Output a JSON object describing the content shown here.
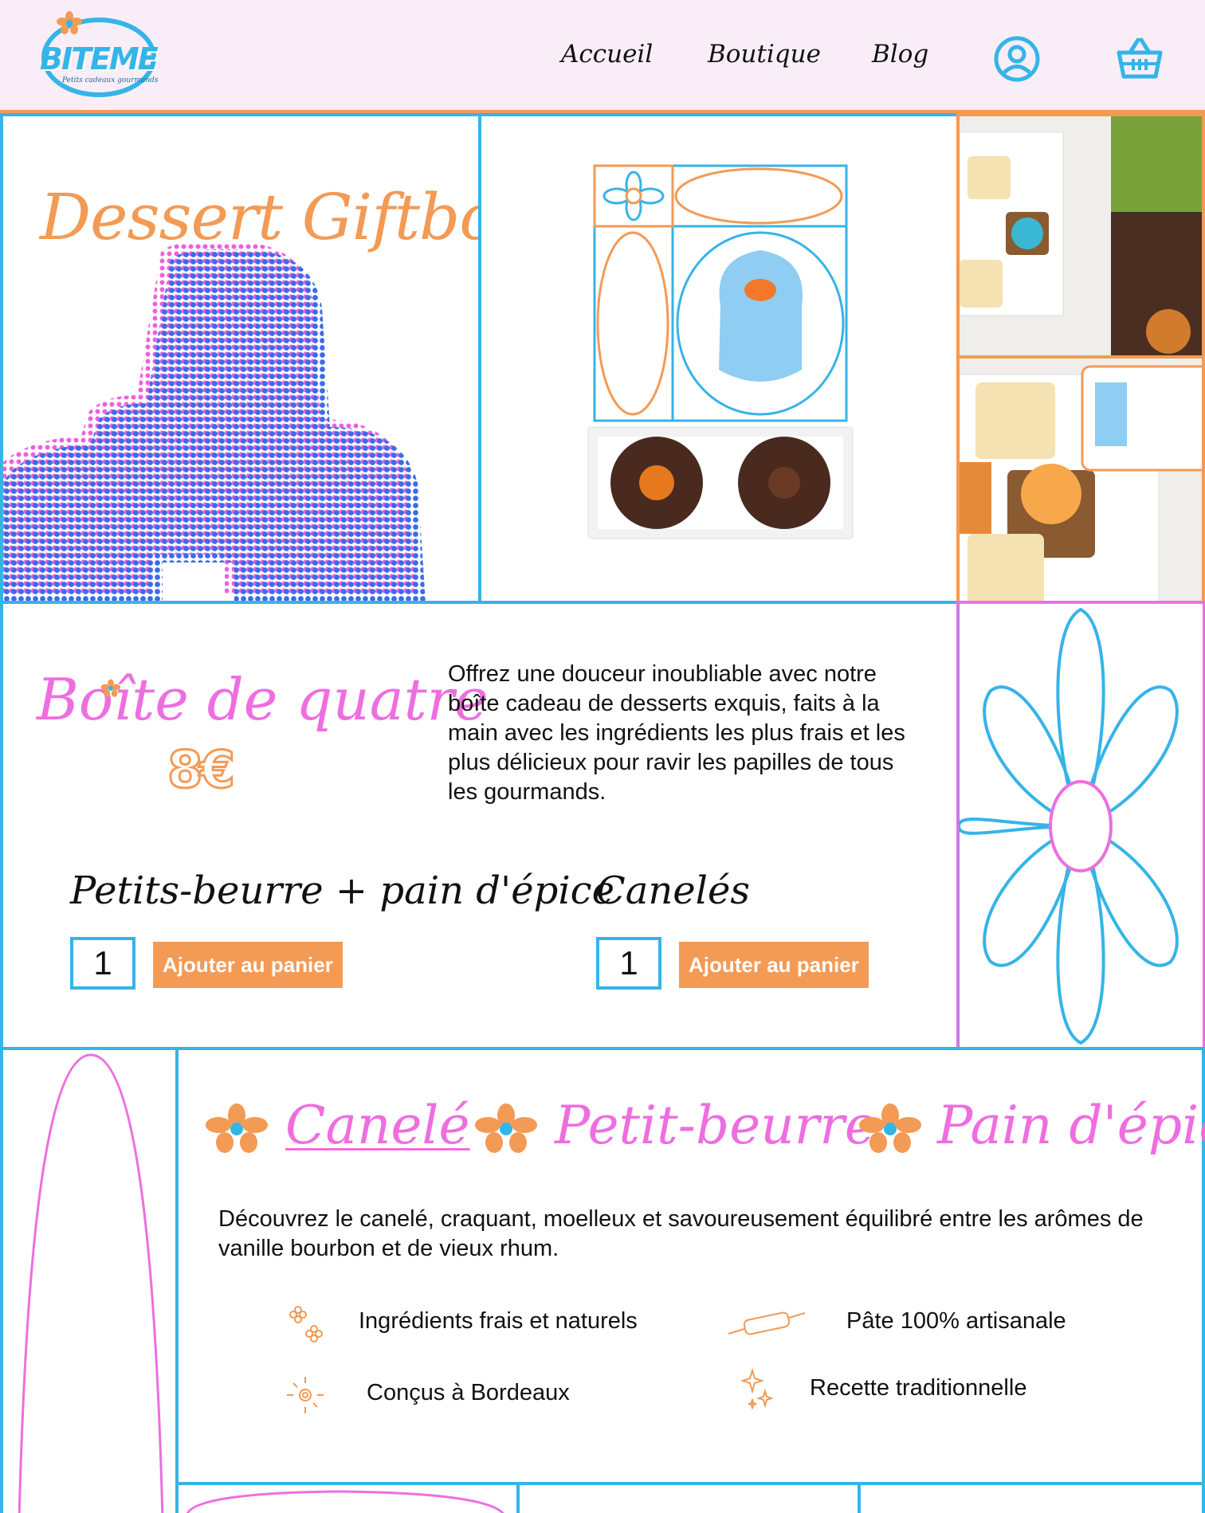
{
  "brand": {
    "name": "BITEME",
    "tagline": "Petits cadeaux gourmands"
  },
  "nav": {
    "items": [
      "Accueil",
      "Boutique",
      "Blog"
    ]
  },
  "hero": {
    "title": "Dessert Giftbox"
  },
  "product": {
    "title": "Boîte de quatre",
    "price": "8€",
    "description": "Offrez une douceur inoubliable avec notre boîte cadeau de desserts exquis, faits à la main avec les ingrédients les plus frais et les plus délicieux pour ravir les papilles de tous les gourmands.",
    "options": [
      {
        "name": "Petits-beurre + pain d'épice",
        "qty": "1",
        "button": "Ajouter au panier"
      },
      {
        "name": "Canelés",
        "qty": "1",
        "button": "Ajouter au panier"
      }
    ]
  },
  "tabs": {
    "items": [
      "Canelé",
      "Petit-beurre",
      "Pain d'épice"
    ],
    "active": "Canelé"
  },
  "info": {
    "text": "Découvrez le canelé, craquant, moelleux et savoureusement équilibré entre les arômes de vanille bourbon et de vieux rhum.",
    "features": [
      {
        "icon": "flowers-icon",
        "label": "Ingrédients frais et naturels"
      },
      {
        "icon": "rolling-pin-icon",
        "label": "Pâte 100% artisanale"
      },
      {
        "icon": "sun-icon",
        "label": "Conçus à Bordeaux"
      },
      {
        "icon": "sparkles-icon",
        "label": "Recette traditionnelle"
      }
    ]
  },
  "colors": {
    "orange": "#f39a55",
    "blue": "#35b4e8",
    "pink": "#ee6ee0",
    "header_bg": "#f9eef7"
  }
}
